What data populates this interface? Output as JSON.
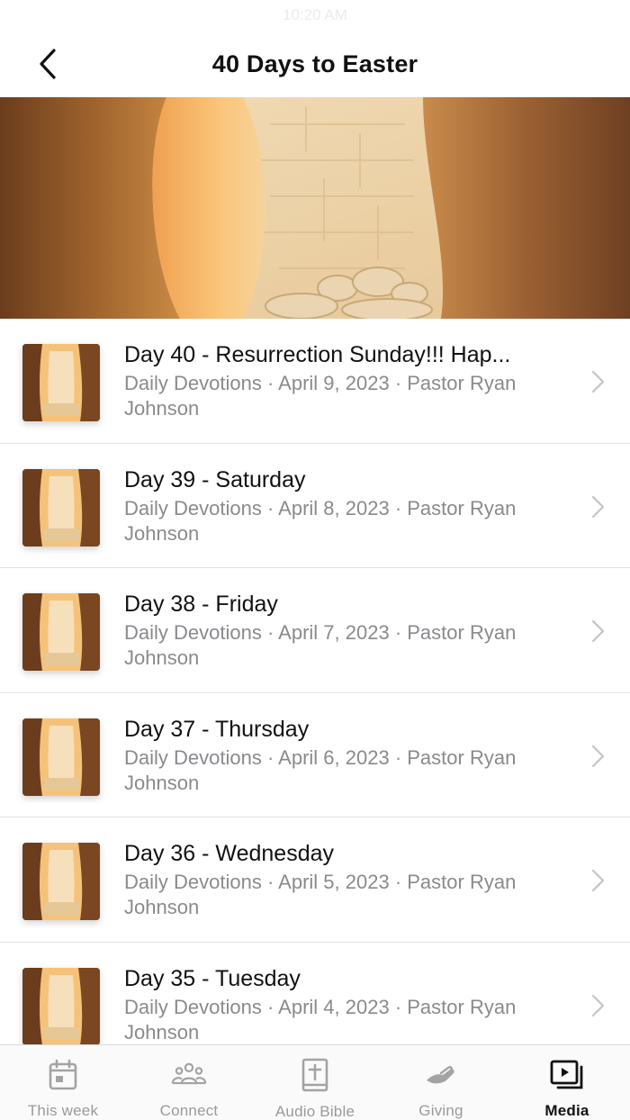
{
  "status_bar": {
    "time": "10:20 AM"
  },
  "header": {
    "title": "40 Days to Easter"
  },
  "colors": {
    "accent": "#111111",
    "muted": "#8a8a8e",
    "tab_inactive": "#9a9a9a"
  },
  "devotions": [
    {
      "title": "Day 40 - Resurrection Sunday!!! Hap...",
      "meta": "Daily Devotions · April 9, 2023 · Pastor Ryan Johnson"
    },
    {
      "title": "Day 39 - Saturday",
      "meta": "Daily Devotions · April 8, 2023 · Pastor Ryan Johnson"
    },
    {
      "title": "Day 38 - Friday",
      "meta": "Daily Devotions · April 7, 2023 · Pastor Ryan Johnson"
    },
    {
      "title": "Day 37 - Thursday",
      "meta": "Daily Devotions · April 6, 2023 · Pastor Ryan Johnson"
    },
    {
      "title": "Day 36 - Wednesday",
      "meta": "Daily Devotions · April 5, 2023 · Pastor Ryan Johnson"
    },
    {
      "title": "Day 35 - Tuesday",
      "meta": "Daily Devotions · April 4, 2023 · Pastor Ryan Johnson"
    }
  ],
  "tabs": [
    {
      "label": "This week",
      "icon": "calendar-icon",
      "active": false
    },
    {
      "label": "Connect",
      "icon": "people-icon",
      "active": false
    },
    {
      "label": "Audio Bible",
      "icon": "bible-icon",
      "active": false
    },
    {
      "label": "Giving",
      "icon": "giving-hand-icon",
      "active": false
    },
    {
      "label": "Media",
      "icon": "media-icon",
      "active": true
    }
  ]
}
